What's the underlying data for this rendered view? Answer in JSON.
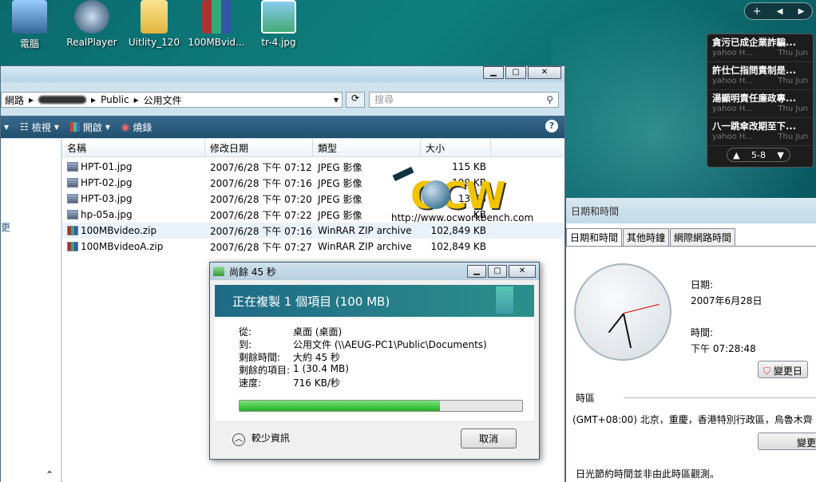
{
  "desktop": {
    "icons": [
      "電腦",
      "RealPlayer",
      "Uitlity_120",
      "100MBvid...",
      "tr-4.jpg"
    ]
  },
  "gadget": {
    "news": [
      {
        "title": "貪污已成企業詐騙...",
        "source": "yahoo H...",
        "date": "Thu Jun"
      },
      {
        "title": "許仕仁指問責制是...",
        "source": "yahoo H...",
        "date": "Thu Jun"
      },
      {
        "title": "湯顯明責任廉政專...",
        "source": "yahoo H...",
        "date": "Thu Jun"
      },
      {
        "title": "八一跳傘改期至下...",
        "source": "yahoo H...",
        "date": "Thu Jun"
      }
    ],
    "pager": "5-8"
  },
  "explorer": {
    "address": [
      "網路",
      "Public",
      "公用文件"
    ],
    "search_placeholder": "搜尋",
    "toolbar": {
      "view": "檢視",
      "open": "開啟",
      "burn": "燒錄"
    },
    "columns": [
      "名稱",
      "修改日期",
      "類型",
      "大小"
    ],
    "files": [
      {
        "name": "HPT-01.jpg",
        "date": "2007/6/28 下午 07:12",
        "type": "JPEG 影像",
        "size": "115 KB",
        "kind": "jpg"
      },
      {
        "name": "HPT-02.jpg",
        "date": "2007/6/28 下午 07:16",
        "type": "JPEG 影像",
        "size": "109 KB",
        "kind": "jpg"
      },
      {
        "name": "HPT-03.jpg",
        "date": "2007/6/28 下午 07:20",
        "type": "JPEG 影像",
        "size": "13 KB",
        "kind": "jpg"
      },
      {
        "name": "hp-05a.jpg",
        "date": "2007/6/28 下午 07:22",
        "type": "JPEG 影像",
        "size": "KB",
        "kind": "jpg"
      },
      {
        "name": "100MBvideo.zip",
        "date": "2007/6/28 下午 07:16",
        "type": "WinRAR ZIP archive",
        "size": "102,849 KB",
        "kind": "zip"
      },
      {
        "name": "100MBvideoA.zip",
        "date": "2007/6/28 下午 07:27",
        "type": "WinRAR ZIP archive",
        "size": "102,849 KB",
        "kind": "zip"
      }
    ],
    "nav_fragment": "更"
  },
  "watermark": {
    "logo": "OCW",
    "url": "http://www.ocworkbench.com"
  },
  "datetime": {
    "title": "日期和時間",
    "tabs": [
      "日期和時間",
      "其他時鐘",
      "網際網路時間"
    ],
    "date_label": "日期:",
    "date_value": "2007年6月28日",
    "time_label": "時間:",
    "time_value": "下午 07:28:48",
    "change_button": "變更日",
    "timezone_label": "時區",
    "timezone_value": "(GMT+08:00) 北京，重慶，香港特別行政區，烏魯木齊",
    "change_tz_button": "變更",
    "dst_note": "日光節約時間並非由此時區觀測。"
  },
  "copy_dialog": {
    "title": "尚餘 45 秒",
    "heading": "正在複製 1 個項目 (100 MB)",
    "rows": [
      {
        "k": "從:",
        "v": "桌面 (桌面)"
      },
      {
        "k": "到:",
        "v": "公用文件 (\\\\AEUG-PC1\\Public\\Documents)"
      },
      {
        "k": "剩餘時間:",
        "v": "大約 45 秒"
      },
      {
        "k": "剩餘的項目:",
        "v": "1 (30.4 MB)"
      },
      {
        "k": "速度:",
        "v": "716 KB/秒"
      }
    ],
    "progress": 0.71,
    "less_info": "較少資訊",
    "cancel": "取消"
  }
}
